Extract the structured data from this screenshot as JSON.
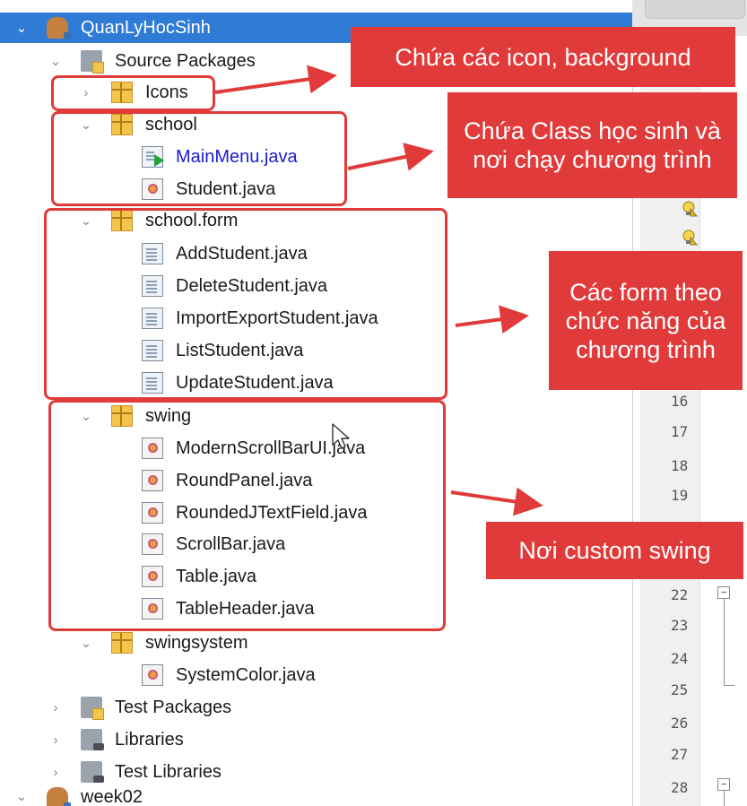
{
  "tree": {
    "project": "QuanLyHocSinh",
    "source_packages": "Source Packages",
    "packages": {
      "icons": "Icons",
      "school": "school",
      "school_files": [
        "MainMenu.java",
        "Student.java"
      ],
      "school_form": "school.form",
      "school_form_files": [
        "AddStudent.java",
        "DeleteStudent.java",
        "ImportExportStudent.java",
        "ListStudent.java",
        "UpdateStudent.java"
      ],
      "swing": "swing",
      "swing_files": [
        "ModernScrollBarUI.java",
        "RoundPanel.java",
        "RoundedJTextField.java",
        "ScrollBar.java",
        "Table.java",
        "TableHeader.java"
      ],
      "swingsystem": "swingsystem",
      "swingsystem_files": [
        "SystemColor.java"
      ]
    },
    "test_packages": "Test Packages",
    "libraries": "Libraries",
    "test_libraries": "Test Libraries",
    "next_project": "week02"
  },
  "gutter": {
    "line_numbers": [
      "16",
      "17",
      "18",
      "19",
      "22",
      "23",
      "24",
      "25",
      "26",
      "27",
      "28"
    ],
    "fold_markers": [
      "−",
      "−"
    ]
  },
  "callouts": {
    "icons": "Chứa các icon, background",
    "school": "Chứa Class học sinh và nơi chạy chương trình",
    "forms": "Các form theo chức năng của chương trình",
    "swing": "Nơi custom swing"
  },
  "colors": {
    "annotation": "#e13a3a",
    "selection": "#2f7bd6"
  }
}
